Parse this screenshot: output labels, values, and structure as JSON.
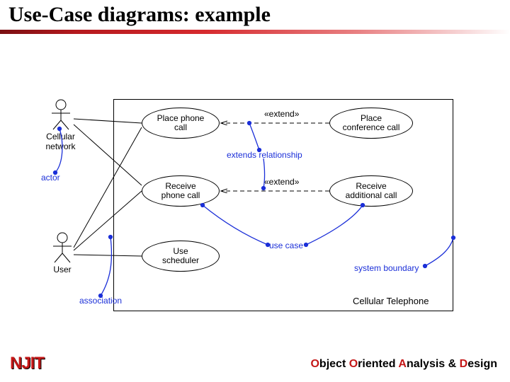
{
  "slide": {
    "title": "Use-Case diagrams: example",
    "logo": "NJIT",
    "footer": {
      "o1": "O",
      "t1": "bject ",
      "o2": "O",
      "t2": "riented ",
      "a": "A",
      "t3": "nalysis & ",
      "d": "D",
      "t4": "esign"
    }
  },
  "diagram": {
    "systemLabel": "Cellular Telephone",
    "actors": {
      "cellular": "Cellular\nnetwork",
      "user": "User"
    },
    "usecases": {
      "placeCall": "Place phone\ncall",
      "receiveCall": "Receive\nphone call",
      "useScheduler": "Use\nscheduler",
      "placeConf": "Place\nconference call",
      "receiveAdd": "Receive\nadditional call"
    },
    "stereotypes": {
      "ext1": "«extend»",
      "ext2": "«extend»"
    },
    "annotations": {
      "actor": "actor",
      "association": "association",
      "extendsRel": "extends relationship",
      "useCase": "use case",
      "sysBoundary": "system boundary"
    }
  }
}
